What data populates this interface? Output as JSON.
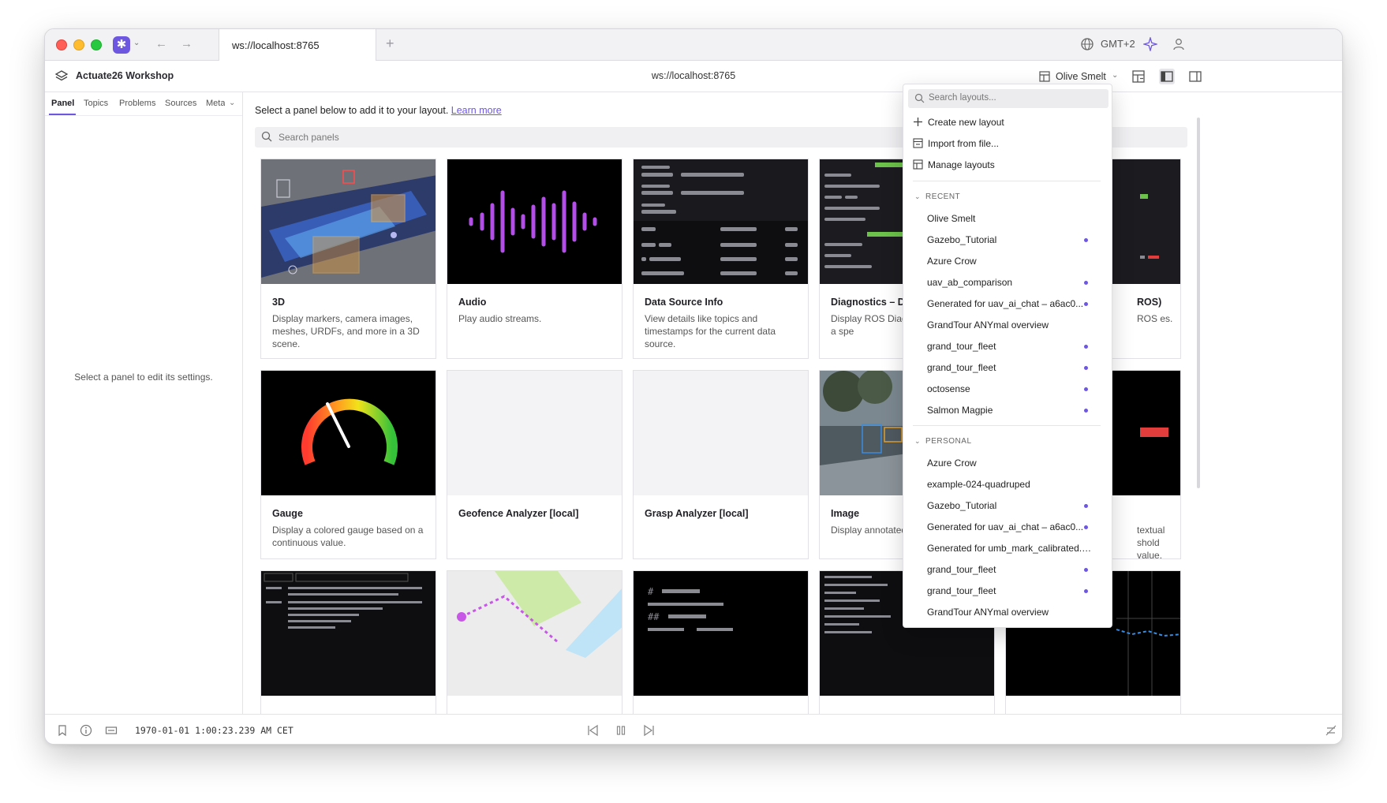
{
  "browser": {
    "tab_title": "ws://localhost:8765",
    "new_tab": "+",
    "timezone": "GMT+2"
  },
  "header": {
    "workspace_name": "Actuate26 Workshop",
    "connection_url": "ws://localhost:8765",
    "layout_name": "Olive Smelt"
  },
  "sidebar": {
    "tabs": [
      "Panel",
      "Topics",
      "Problems",
      "Sources",
      "Meta"
    ],
    "active_tab": "Panel",
    "empty_message": "Select a panel to edit its settings."
  },
  "main": {
    "intro": "Select a panel below to add it to your layout.",
    "learn_more": "Learn more",
    "search_placeholder": "Search panels",
    "cards": [
      {
        "title": "3D",
        "description": "Display markers, camera images, meshes, URDFs, and more in a 3D scene."
      },
      {
        "title": "Audio",
        "description": "Play audio streams."
      },
      {
        "title": "Data Source Info",
        "description": "View details like topics and timestamps for the current data source."
      },
      {
        "title": "Diagnostics – Deta",
        "description": "Display ROS Diagno messages for a spe"
      },
      {
        "title": "ROS)",
        "description": "ROS es."
      },
      {
        "title": "Gauge",
        "description": "Display a colored gauge based on a continuous value."
      },
      {
        "title": "Geofence Analyzer [local]",
        "description": ""
      },
      {
        "title": "Grasp Analyzer [local]",
        "description": ""
      },
      {
        "title": "Image",
        "description": "Display annotated i"
      },
      {
        "title": "",
        "description": "textual shold value."
      }
    ]
  },
  "statusbar": {
    "timestamp": "1970-01-01 1:00:23.239 AM CET"
  },
  "dropdown": {
    "search_placeholder": "Search layouts...",
    "actions": [
      "Create new layout",
      "Import from file...",
      "Manage layouts"
    ],
    "recent_label": "RECENT",
    "recent": [
      {
        "name": "Olive Smelt",
        "modified": false
      },
      {
        "name": "Gazebo_Tutorial",
        "modified": true
      },
      {
        "name": "Azure Crow",
        "modified": false
      },
      {
        "name": "uav_ab_comparison",
        "modified": true
      },
      {
        "name": "Generated for uav_ai_chat – a6ac0...",
        "modified": true
      },
      {
        "name": "GrandTour ANYmal overview",
        "modified": false
      },
      {
        "name": "grand_tour_fleet",
        "modified": true
      },
      {
        "name": "grand_tour_fleet",
        "modified": true
      },
      {
        "name": "octosense",
        "modified": true
      },
      {
        "name": "Salmon Magpie",
        "modified": true
      }
    ],
    "personal_label": "PERSONAL",
    "personal": [
      {
        "name": "Azure Crow",
        "modified": false
      },
      {
        "name": "example-024-quadruped",
        "modified": false
      },
      {
        "name": "Gazebo_Tutorial",
        "modified": true
      },
      {
        "name": "Generated for uav_ai_chat – a6ac0...",
        "modified": true
      },
      {
        "name": "Generated for umb_mark_calibrated.m...",
        "modified": false
      },
      {
        "name": "grand_tour_fleet",
        "modified": true
      },
      {
        "name": "grand_tour_fleet",
        "modified": true
      },
      {
        "name": "GrandTour ANYmal overview",
        "modified": false
      }
    ]
  },
  "colors": {
    "accent": "#6e57e0",
    "dot": "#6e57e0"
  }
}
